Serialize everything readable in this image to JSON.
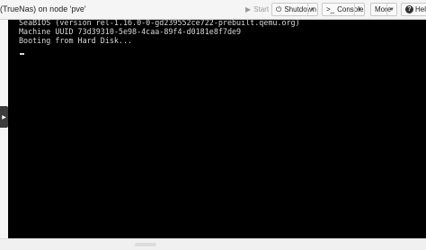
{
  "window": {
    "title": "(TrueNas) on node 'pve'"
  },
  "toolbar": {
    "start_label": "Start",
    "shutdown_label": "Shutdown",
    "console_label": "Console",
    "more_label": "More",
    "help_label": "Help"
  },
  "console": {
    "lines": [
      "SeaBIOS (version rel-1.16.0-0-gd239552ce722-prebuilt.qemu.org)",
      "Machine UUID 73d39310-5e98-4caa-89f4-d0181e8f7de9",
      "Booting from Hard Disk..."
    ],
    "background": "#000000",
    "text_color": "#d8d8d8"
  },
  "icons": {
    "start": "play-icon",
    "shutdown": "power-icon",
    "console": "terminal-icon",
    "help": "question-circle-icon",
    "side_handle": "chevron-right-icon"
  }
}
